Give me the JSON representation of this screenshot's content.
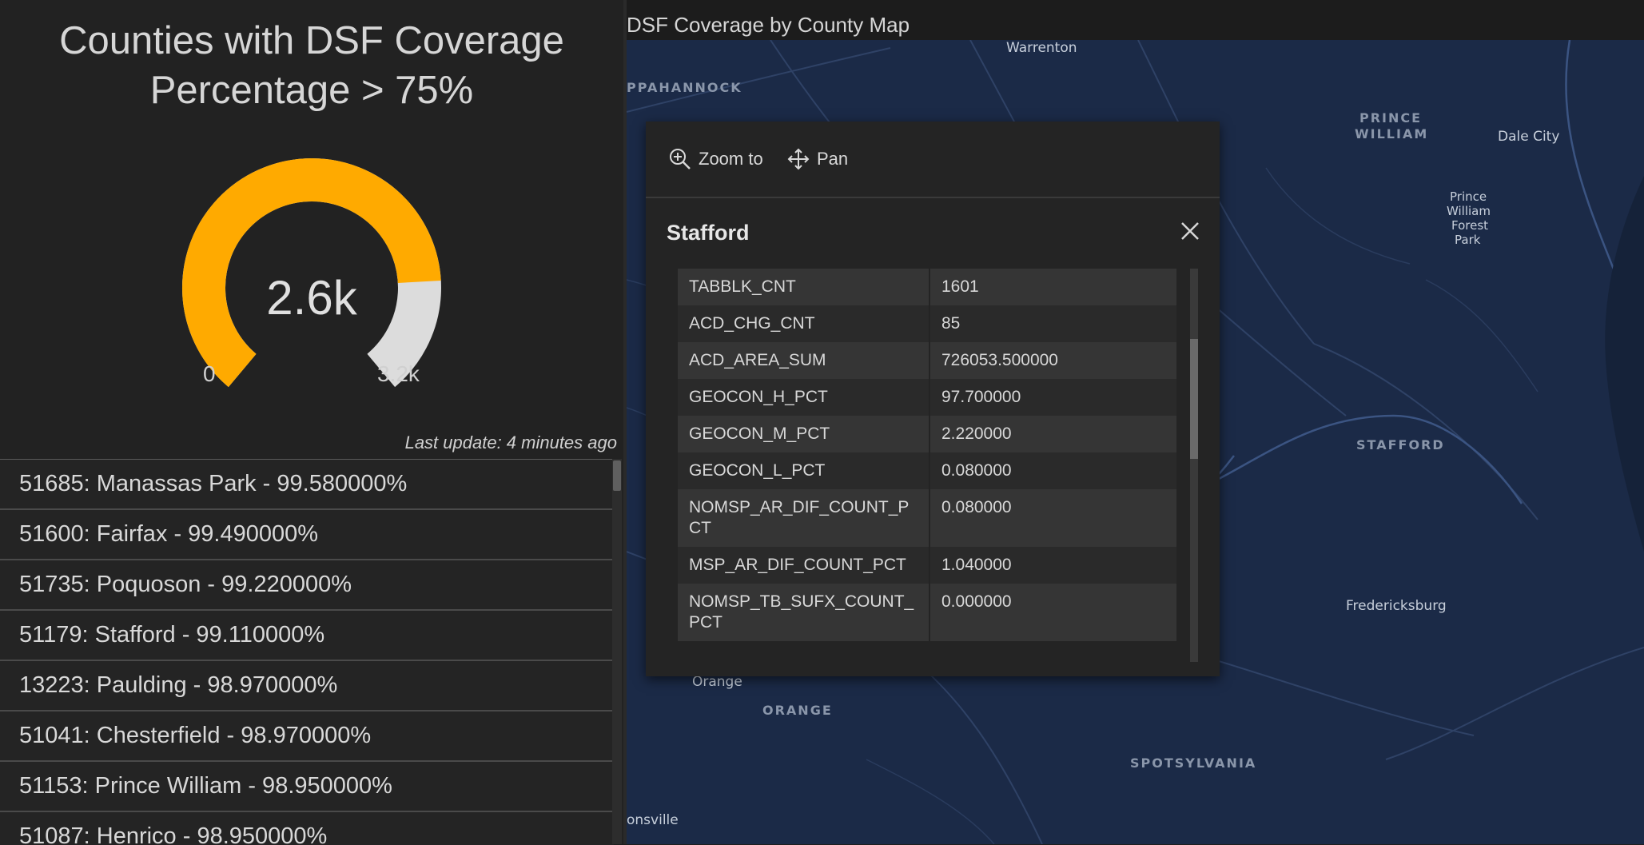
{
  "gauge": {
    "title_line1": "Counties with DSF Coverage",
    "title_line2": "Percentage > 75%",
    "value_label": "2.6k",
    "min_label": "0",
    "max_label": "3.2k",
    "fill_fraction": 0.81,
    "fill_color": "#ffaa00",
    "track_color": "#dcdcdc",
    "last_update": "Last update: 4 minutes ago"
  },
  "list": {
    "items": [
      "51685: Manassas Park - 99.580000%",
      "51600: Fairfax - 99.490000%",
      "51735: Poquoson - 99.220000%",
      "51179: Stafford - 99.110000%",
      "13223: Paulding - 98.970000%",
      "51041: Chesterfield - 98.970000%",
      "51153: Prince William - 98.950000%",
      "51087: Henrico - 98.950000%"
    ]
  },
  "map": {
    "title": "DSF Coverage by County Map",
    "labels": {
      "warrenton": "Warrenton",
      "rappahannock": "PPAHANNOCK",
      "prince_william_1": "PRINCE",
      "prince_william_2": "WILLIAM",
      "dale_city": "Dale City",
      "pwfp_1": "Prince",
      "pwfp_2": "William",
      "pwfp_3": "Forest",
      "pwfp_4": "Park",
      "stafford": "STAFFORD",
      "fredericksburg": "Fredericksburg",
      "orange_city": "Orange",
      "orange_county": "ORANGE",
      "spotsylvania": "SPOTSYLVANIA",
      "gordonsville": "onsville"
    }
  },
  "popup": {
    "zoom_label": "Zoom to",
    "pan_label": "Pan",
    "title": "Stafford",
    "rows": [
      {
        "key": "TABBLK_CNT",
        "value": "1601"
      },
      {
        "key": "ACD_CHG_CNT",
        "value": "85"
      },
      {
        "key": "ACD_AREA_SUM",
        "value": "726053.500000"
      },
      {
        "key": "GEOCON_H_PCT",
        "value": "97.700000"
      },
      {
        "key": "GEOCON_M_PCT",
        "value": "2.220000"
      },
      {
        "key": "GEOCON_L_PCT",
        "value": "0.080000"
      },
      {
        "key": "NOMSP_AR_DIF_COUNT_PCT",
        "value": "0.080000"
      },
      {
        "key": "MSP_AR_DIF_COUNT_PCT",
        "value": "1.040000"
      },
      {
        "key": "NOMSP_TB_SUFX_COUNT_PCT",
        "value": "0.000000"
      }
    ]
  },
  "icons": {
    "zoom": "zoom-in-icon",
    "pan": "pan-move-icon",
    "close": "close-icon"
  }
}
